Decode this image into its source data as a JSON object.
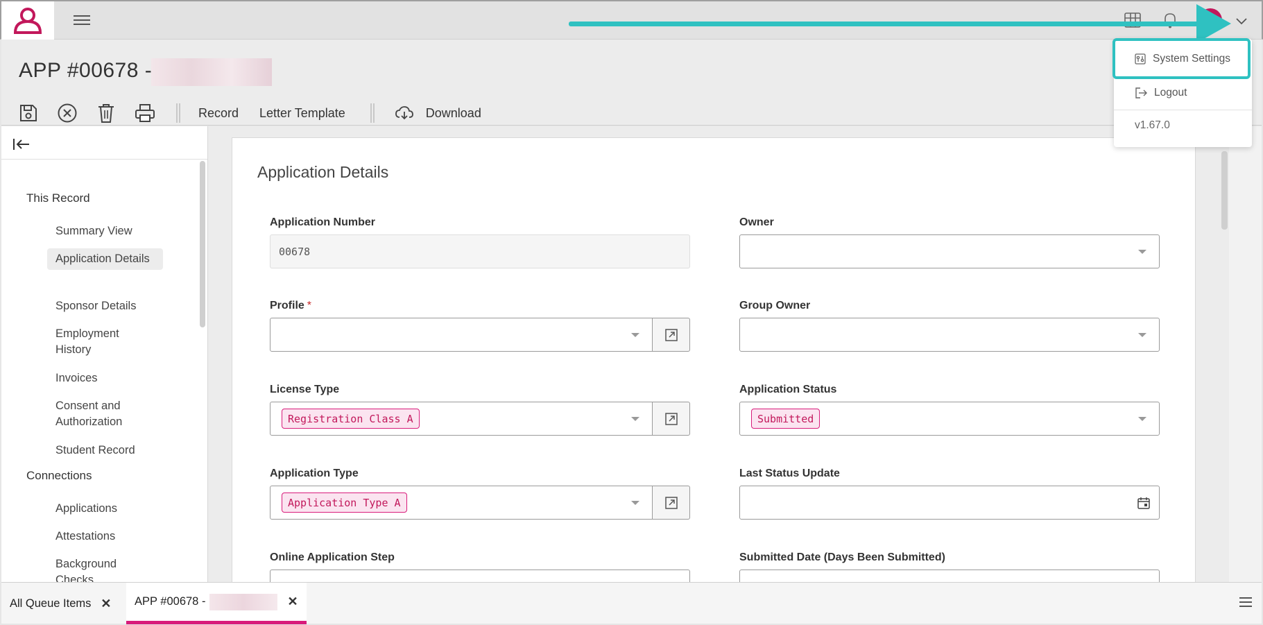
{
  "topbar": {
    "icons": [
      "app-logo",
      "hamburger-menu-icon",
      "apps-grid-icon",
      "bell-icon",
      "user-avatar",
      "chevron-down-icon"
    ],
    "accent_color": "#d81b7a",
    "annotation_color": "#2fc1c1"
  },
  "user_menu": {
    "items": [
      {
        "label": "System Settings",
        "icon": "settings-sliders-icon"
      },
      {
        "label": "Logout",
        "icon": "logout-icon"
      }
    ],
    "version": "v1.67.0"
  },
  "header": {
    "title": "APP #00678 -",
    "toolbar": {
      "icons": [
        "save-icon",
        "cancel-icon",
        "delete-icon",
        "print-icon"
      ],
      "record_label": "Record",
      "letter_template_label": "Letter Template",
      "download_label": "Download"
    }
  },
  "sidebar": {
    "section_this_record": "This Record",
    "items": [
      "Summary View",
      "Application Details",
      "Sponsor Details",
      "Employment History",
      "Invoices",
      "Consent and Authorization",
      "Student Record"
    ],
    "section_connections": "Connections",
    "connection_items": [
      "Applications",
      "Attestations",
      "Background Checks"
    ],
    "active_item": "Application Details"
  },
  "form": {
    "title": "Application Details",
    "application_number": {
      "label": "Application Number",
      "value": "00678"
    },
    "owner": {
      "label": "Owner",
      "value": ""
    },
    "profile": {
      "label": "Profile",
      "required_mark": "*",
      "value": ""
    },
    "group_owner": {
      "label": "Group Owner",
      "value": ""
    },
    "license_type": {
      "label": "License Type",
      "value": "Registration Class A"
    },
    "application_status": {
      "label": "Application Status",
      "value": "Submitted"
    },
    "application_type": {
      "label": "Application Type",
      "value": "Application Type A"
    },
    "last_status_update": {
      "label": "Last Status Update",
      "value": ""
    },
    "online_application_step": {
      "label": "Online Application Step"
    },
    "submitted_date": {
      "label": "Submitted Date (Days Been Submitted)"
    }
  },
  "bottom_tabs": {
    "tabs": [
      {
        "label": "All Queue Items",
        "close": "✕"
      },
      {
        "label": "APP #00678 -",
        "close": "✕"
      }
    ]
  }
}
